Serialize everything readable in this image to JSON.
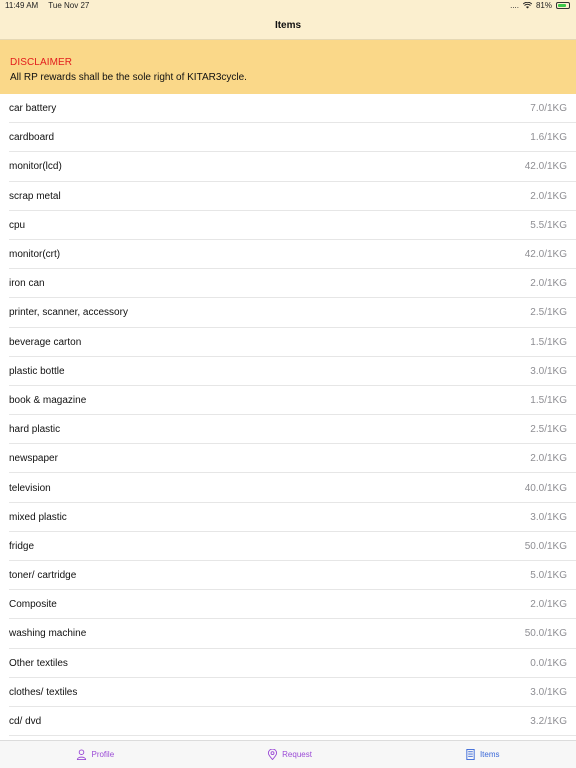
{
  "status": {
    "time": "11:49 AM",
    "date": "Tue Nov 27",
    "signal": "....",
    "battery": "81%"
  },
  "nav": {
    "title": "Items"
  },
  "disclaimer": {
    "title": "DISCLAIMER",
    "text": "All RP rewards shall be the sole right of KITAR3cycle."
  },
  "items": [
    {
      "name": "car battery",
      "price": "7.0/1KG"
    },
    {
      "name": "cardboard",
      "price": "1.6/1KG"
    },
    {
      "name": "monitor(lcd)",
      "price": "42.0/1KG"
    },
    {
      "name": "scrap metal",
      "price": "2.0/1KG"
    },
    {
      "name": "cpu",
      "price": "5.5/1KG"
    },
    {
      "name": "monitor(crt)",
      "price": "42.0/1KG"
    },
    {
      "name": "iron can",
      "price": "2.0/1KG"
    },
    {
      "name": "printer, scanner, accessory",
      "price": "2.5/1KG"
    },
    {
      "name": "beverage carton",
      "price": "1.5/1KG"
    },
    {
      "name": "plastic bottle",
      "price": "3.0/1KG"
    },
    {
      "name": "book & magazine",
      "price": "1.5/1KG"
    },
    {
      "name": "hard plastic",
      "price": "2.5/1KG"
    },
    {
      "name": "newspaper",
      "price": "2.0/1KG"
    },
    {
      "name": "television",
      "price": "40.0/1KG"
    },
    {
      "name": "mixed plastic",
      "price": "3.0/1KG"
    },
    {
      "name": "fridge",
      "price": "50.0/1KG"
    },
    {
      "name": "toner/ cartridge",
      "price": "5.0/1KG"
    },
    {
      "name": "Composite",
      "price": "2.0/1KG"
    },
    {
      "name": "washing machine",
      "price": "50.0/1KG"
    },
    {
      "name": "Other textiles",
      "price": "0.0/1KG"
    },
    {
      "name": "clothes/ textiles",
      "price": "3.0/1KG"
    },
    {
      "name": "cd/ dvd",
      "price": "3.2/1KG"
    }
  ],
  "tabs": [
    {
      "label": "Profile",
      "icon": "person-icon"
    },
    {
      "label": "Request",
      "icon": "location-pin-icon"
    },
    {
      "label": "Items",
      "icon": "list-icon"
    }
  ],
  "colors": {
    "header_bg": "#fbefcf",
    "disclaimer_bg": "#fad889",
    "disclaimer_title": "#e21d1d",
    "tab_color": "#9b4bd6",
    "tab_active": "#3a68d8"
  }
}
